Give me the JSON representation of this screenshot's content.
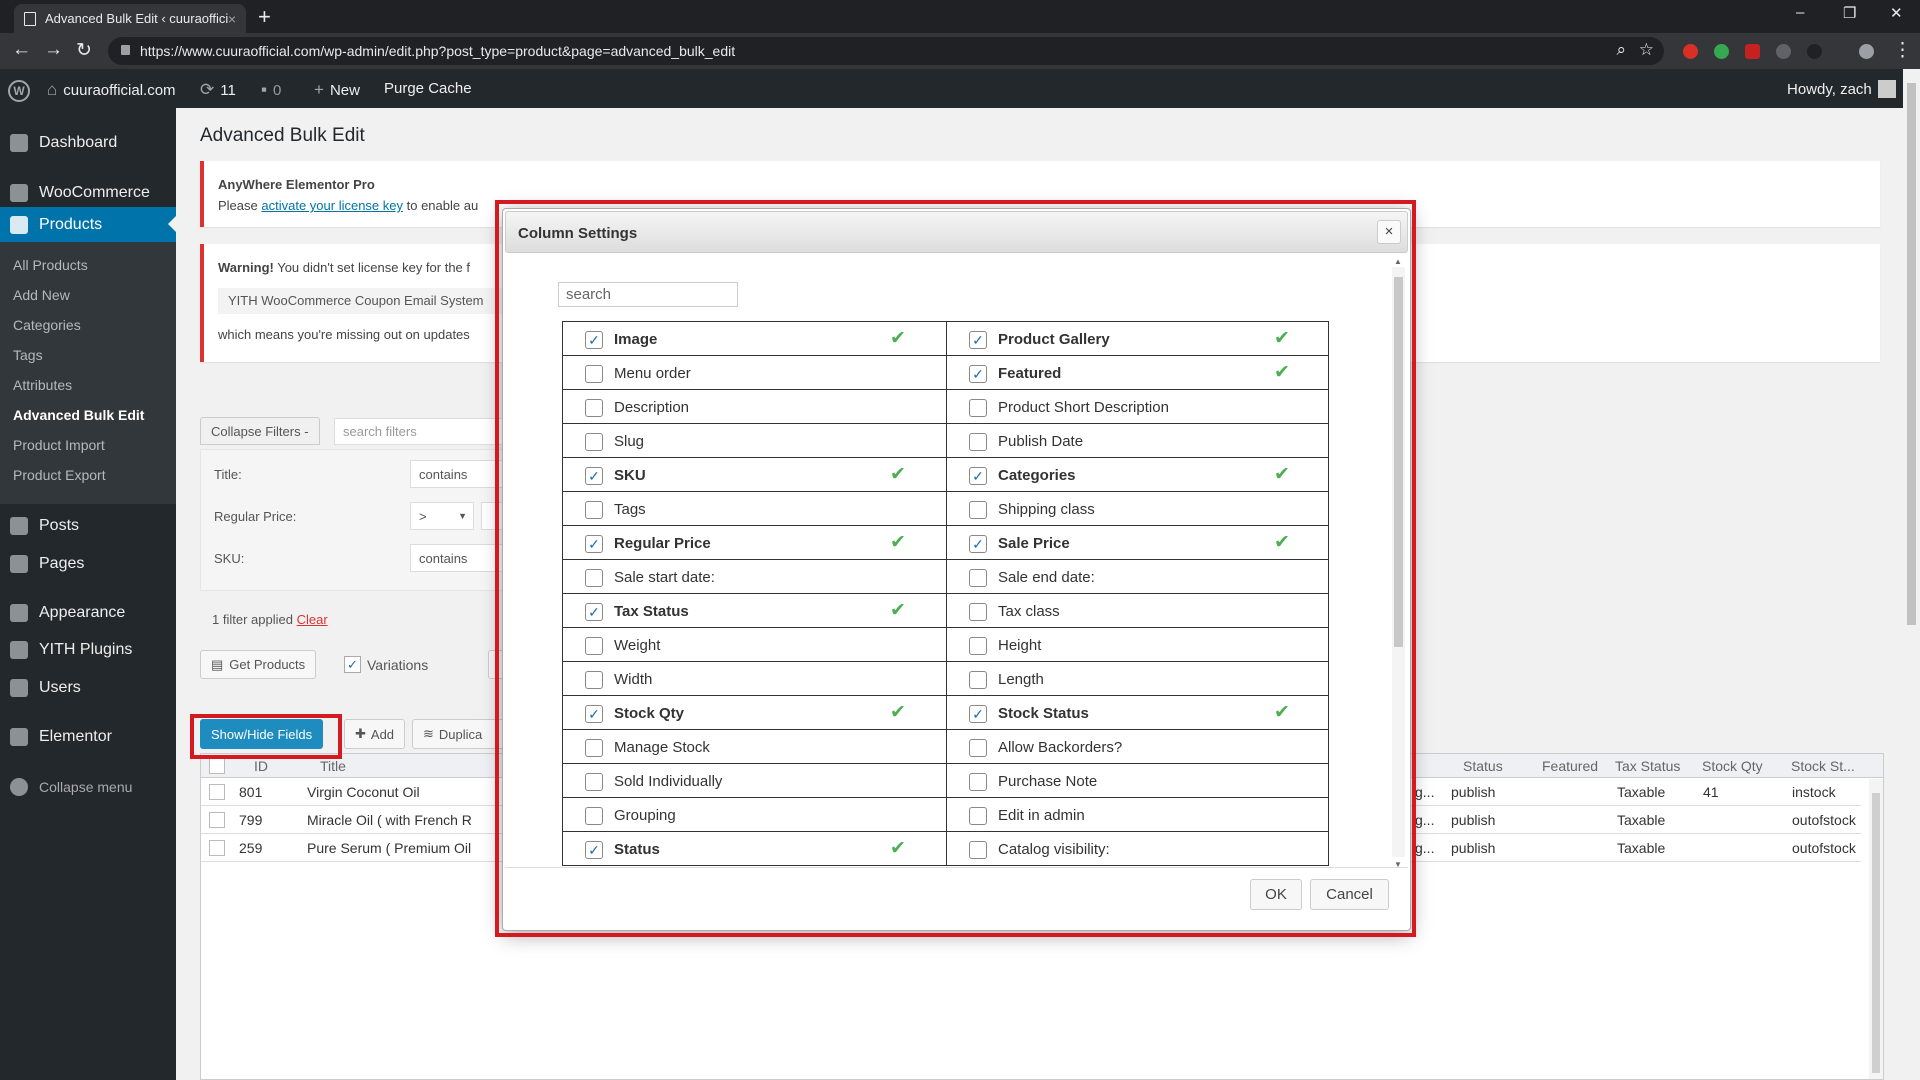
{
  "browser": {
    "tab_title": "Advanced Bulk Edit ‹ cuuraoffici",
    "tab_close": "×",
    "new_tab": "+",
    "url": "https://www.cuuraofficial.com/wp-admin/edit.php?post_type=product&page=advanced_bulk_edit",
    "back": "←",
    "forward": "→",
    "reload": "↻",
    "zoom": "⌕",
    "star": "☆",
    "menu": "⋮",
    "min": "–",
    "restore": "❐",
    "close": "✕"
  },
  "adminbar": {
    "wp": "W",
    "site": "cuuraofficial.com",
    "updates": "11",
    "comments": "0",
    "new": "New",
    "purge": "Purge Cache",
    "howdy": "Howdy, zach"
  },
  "sidebar": {
    "dashboard": "Dashboard",
    "woocommerce": "WooCommerce",
    "products": "Products",
    "posts": "Posts",
    "pages": "Pages",
    "appearance": "Appearance",
    "yith": "YITH Plugins",
    "users": "Users",
    "elementor": "Elementor",
    "collapse": "Collapse menu",
    "sub": [
      "All Products",
      "Add New",
      "Categories",
      "Tags",
      "Attributes",
      "Advanced Bulk Edit",
      "Product Import",
      "Product Export"
    ]
  },
  "page": {
    "title": "Advanced Bulk Edit",
    "notice1": {
      "title": "AnyWhere Elementor Pro",
      "text_pre": "Please ",
      "link": "activate your license key",
      "text_post": " to enable au"
    },
    "notice2": {
      "warning": "Warning!",
      "text": " You didn't set license key for the f",
      "coupon": "YITH WooCommerce Coupon Email System",
      "missing": "which means you're missing out on updates"
    },
    "collapse_filters": "Collapse Filters -",
    "search_filters": "search filters",
    "filters": [
      {
        "label": "Title:",
        "op": "contains"
      },
      {
        "label": "Regular Price:",
        "op": ">"
      },
      {
        "label": "SKU:",
        "op": "contains"
      }
    ],
    "filter_applied": "1 filter applied",
    "clear": "Clear",
    "get_products": "Get Products",
    "variations": "Variations",
    "show_hide": "Show/Hide Fields",
    "add": "Add",
    "duplicate": "Duplica"
  },
  "grid": {
    "headers": {
      "id": "ID",
      "title": "Title",
      "status": "Status",
      "featured": "Featured",
      "tax": "Tax Status",
      "qty": "Stock Qty",
      "stock": "Stock St..."
    },
    "rows": [
      {
        "id": "801",
        "title": "Virgin Coconut Oil",
        "cut": "g...",
        "status": "publish",
        "tax": "Taxable",
        "qty": "41",
        "stock": "instock"
      },
      {
        "id": "799",
        "title": "Miracle Oil ( with French R",
        "cut": "g...",
        "status": "publish",
        "tax": "Taxable",
        "qty": "",
        "stock": "outofstock"
      },
      {
        "id": "259",
        "title": "Pure Serum ( Premium Oil",
        "cut": "g...",
        "status": "publish",
        "tax": "Taxable",
        "qty": "",
        "stock": "outofstock"
      }
    ]
  },
  "modal": {
    "title": "Column Settings",
    "close": "×",
    "search_placeholder": "search",
    "ok": "OK",
    "cancel": "Cancel",
    "check": "✔",
    "rows": [
      {
        "l": {
          "label": "Image",
          "checked": true
        },
        "r": {
          "label": "Product Gallery",
          "checked": true
        }
      },
      {
        "l": {
          "label": "Menu order",
          "checked": false
        },
        "r": {
          "label": "Featured",
          "checked": true
        }
      },
      {
        "l": {
          "label": "Description",
          "checked": false
        },
        "r": {
          "label": "Product Short Description",
          "checked": false
        }
      },
      {
        "l": {
          "label": "Slug",
          "checked": false
        },
        "r": {
          "label": "Publish Date",
          "checked": false
        }
      },
      {
        "l": {
          "label": "SKU",
          "checked": true
        },
        "r": {
          "label": "Categories",
          "checked": true
        }
      },
      {
        "l": {
          "label": "Tags",
          "checked": false
        },
        "r": {
          "label": "Shipping class",
          "checked": false
        }
      },
      {
        "l": {
          "label": "Regular Price",
          "checked": true
        },
        "r": {
          "label": "Sale Price",
          "checked": true
        }
      },
      {
        "l": {
          "label": "Sale start date:",
          "checked": false
        },
        "r": {
          "label": "Sale end date:",
          "checked": false
        }
      },
      {
        "l": {
          "label": "Tax Status",
          "checked": true
        },
        "r": {
          "label": "Tax class",
          "checked": false
        }
      },
      {
        "l": {
          "label": "Weight",
          "checked": false
        },
        "r": {
          "label": "Height",
          "checked": false
        }
      },
      {
        "l": {
          "label": "Width",
          "checked": false
        },
        "r": {
          "label": "Length",
          "checked": false
        }
      },
      {
        "l": {
          "label": "Stock Qty",
          "checked": true
        },
        "r": {
          "label": "Stock Status",
          "checked": true
        }
      },
      {
        "l": {
          "label": "Manage Stock",
          "checked": false
        },
        "r": {
          "label": "Allow Backorders?",
          "checked": false
        }
      },
      {
        "l": {
          "label": "Sold Individually",
          "checked": false
        },
        "r": {
          "label": "Purchase Note",
          "checked": false
        }
      },
      {
        "l": {
          "label": "Grouping",
          "checked": false
        },
        "r": {
          "label": "Edit in admin",
          "checked": false
        }
      },
      {
        "l": {
          "label": "Status",
          "checked": true
        },
        "r": {
          "label": "Catalog visibility:",
          "checked": false
        }
      }
    ]
  },
  "colors": {
    "wp_dark": "#23282d",
    "wp_blue": "#0073aa",
    "highlight_red": "#d51920",
    "check_green": "#4caf50"
  }
}
